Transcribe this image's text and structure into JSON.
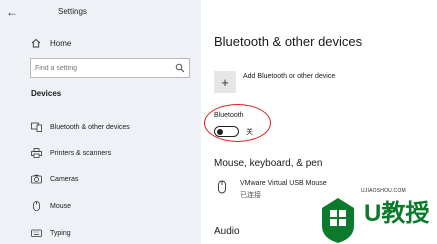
{
  "window": {
    "title": "Settings"
  },
  "sidebar": {
    "home_label": "Home",
    "search_placeholder": "Find a setting",
    "section_title": "Devices",
    "items": [
      {
        "label": "Bluetooth & other devices",
        "icon": "bluetooth-devices-icon"
      },
      {
        "label": "Printers & scanners",
        "icon": "printer-icon"
      },
      {
        "label": "Cameras",
        "icon": "camera-icon"
      },
      {
        "label": "Mouse",
        "icon": "mouse-icon"
      },
      {
        "label": "Typing",
        "icon": "keyboard-icon"
      }
    ]
  },
  "main": {
    "title": "Bluetooth & other devices",
    "add_device_label": "Add Bluetooth or other device",
    "bluetooth_label": "Bluetooth",
    "bluetooth_state": "关",
    "bluetooth_on": false,
    "mouse_section_title": "Mouse, keyboard, & pen",
    "device_name": "VMware Virtual USB Mouse",
    "device_status": "已连接",
    "audio_section_title": "Audio"
  },
  "watermark": {
    "brand": "U教授",
    "site": "UJIAOSHOU.COM"
  },
  "colors": {
    "sidebar_bg": "#eef2f7",
    "highlight_ring": "#d81e1e",
    "logo_green": "#0c7a2c"
  }
}
